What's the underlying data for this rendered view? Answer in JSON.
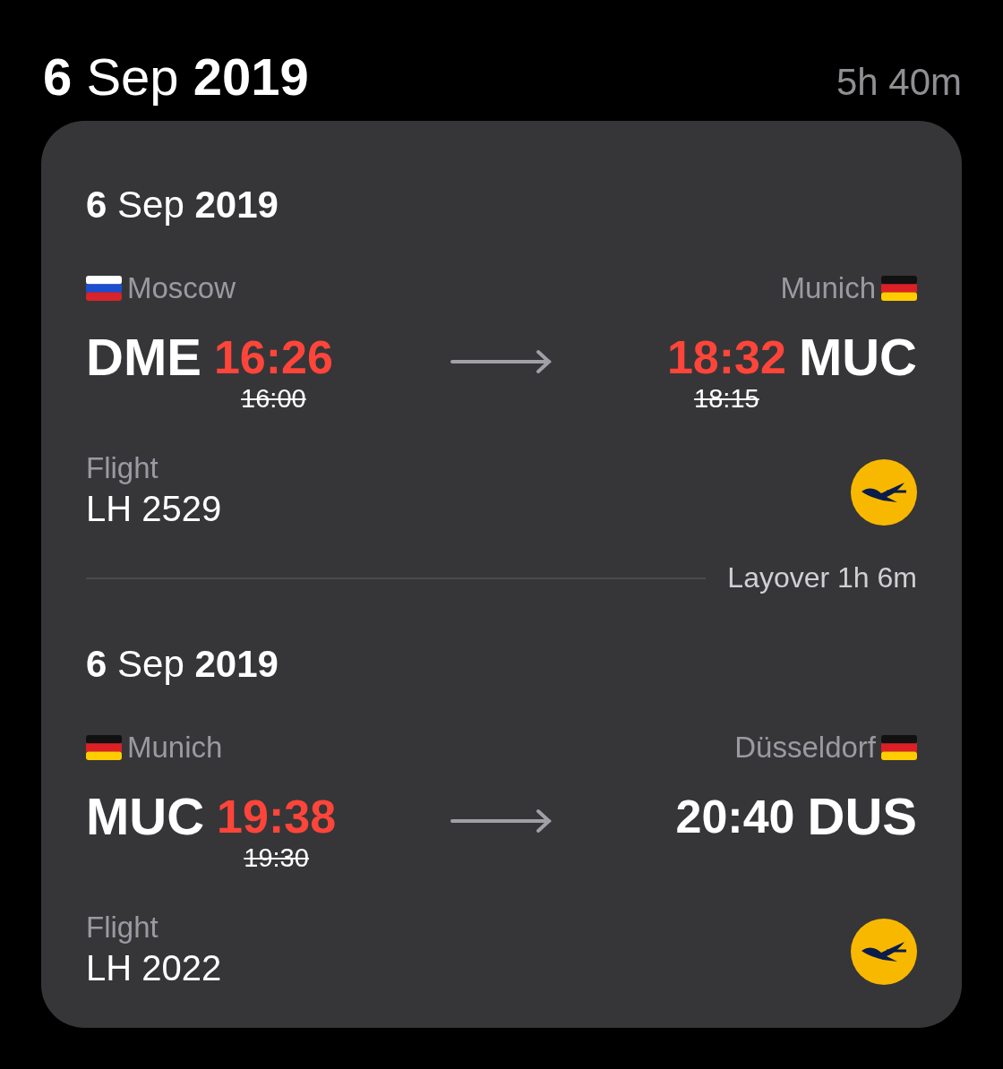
{
  "header": {
    "date": "**6** Sep **2019**",
    "duration": "5h 40m"
  },
  "legs": [
    {
      "date": "**6** Sep **2019**",
      "from": {
        "kind": "russia",
        "city": "Moscow",
        "code": "DME",
        "time": "16:26",
        "delayed": true,
        "scheduled": "16:00"
      },
      "to": {
        "kind": "germany",
        "city": "Munich",
        "code": "MUC",
        "time": "18:32",
        "delayed": true,
        "scheduled": "18:15"
      },
      "flight_label": "Flight",
      "flight_number": "LH 2529",
      "layover": "Layover 1h 6m"
    },
    {
      "date": "**6** Sep **2019**",
      "from": {
        "kind": "germany",
        "city": "Munich",
        "code": "MUC",
        "time": "19:38",
        "delayed": true,
        "scheduled": "19:30"
      },
      "to": {
        "kind": "germany",
        "city": "Düsseldorf",
        "code": "DUS",
        "time": "20:40",
        "delayed": false
      },
      "flight_label": "Flight",
      "flight_number": "LH 2022"
    }
  ]
}
